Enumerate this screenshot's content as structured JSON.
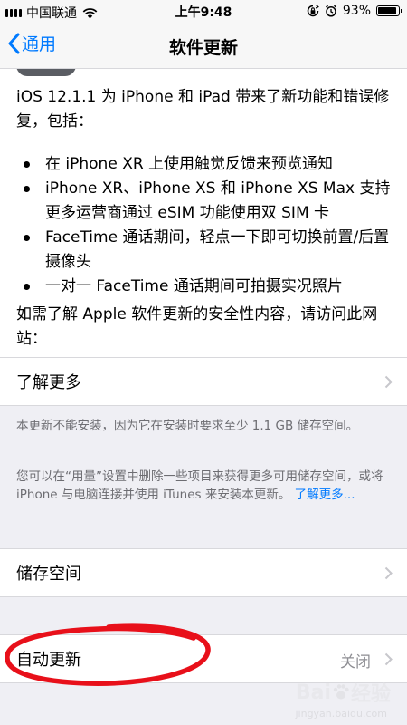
{
  "status": {
    "carrier": "中国联通",
    "time": "上午9:48",
    "battery": "93%",
    "battery_level": 0.93
  },
  "nav": {
    "back_label": "通用",
    "title": "软件更新"
  },
  "update": {
    "intro": "iOS 12.1.1 为 iPhone 和 iPad 带来了新功能和错误修复，包括：",
    "features": [
      "在 iPhone XR 上使用触觉反馈来预览通知",
      "iPhone XR、iPhone XS 和 iPhone XS Max 支持更多运营商通过 eSIM 功能使用双 SIM 卡",
      "FaceTime 通话期间，轻点一下即可切换前置/后置摄像头",
      "一对一 FaceTime 通话期间可拍摄实况照片"
    ],
    "security": "如需了解 Apple 软件更新的安全性内容，请访问此网站："
  },
  "learn_more_row": {
    "label": "了解更多"
  },
  "notes": {
    "cannot_install": "本更新不能安装，因为它在安装时要求至少 1.1 GB 储存空间。",
    "suggestion": "您可以在“用量”设置中删除一些项目来获得更多可用储存空间，或将 iPhone 与电脑连接并使用 iTunes 来安装本更新。",
    "learn_more_link": "了解更多..."
  },
  "storage_row": {
    "label": "储存空间"
  },
  "auto_update_row": {
    "label": "自动更新",
    "value": "关闭"
  },
  "watermark": {
    "brand": "Bai",
    "suffix": "经验",
    "sub": "jingyan.baidu.com"
  },
  "colors": {
    "accent": "#007aff",
    "annotation": "#e8101a",
    "background": "#efeff4",
    "secondary_text": "#8e8e93"
  },
  "icons": [
    "signal-icon",
    "wifi-icon",
    "rotation-lock-icon",
    "alarm-icon",
    "battery-icon",
    "chevron-left-icon",
    "chevron-right-icon",
    "paw-icon"
  ]
}
